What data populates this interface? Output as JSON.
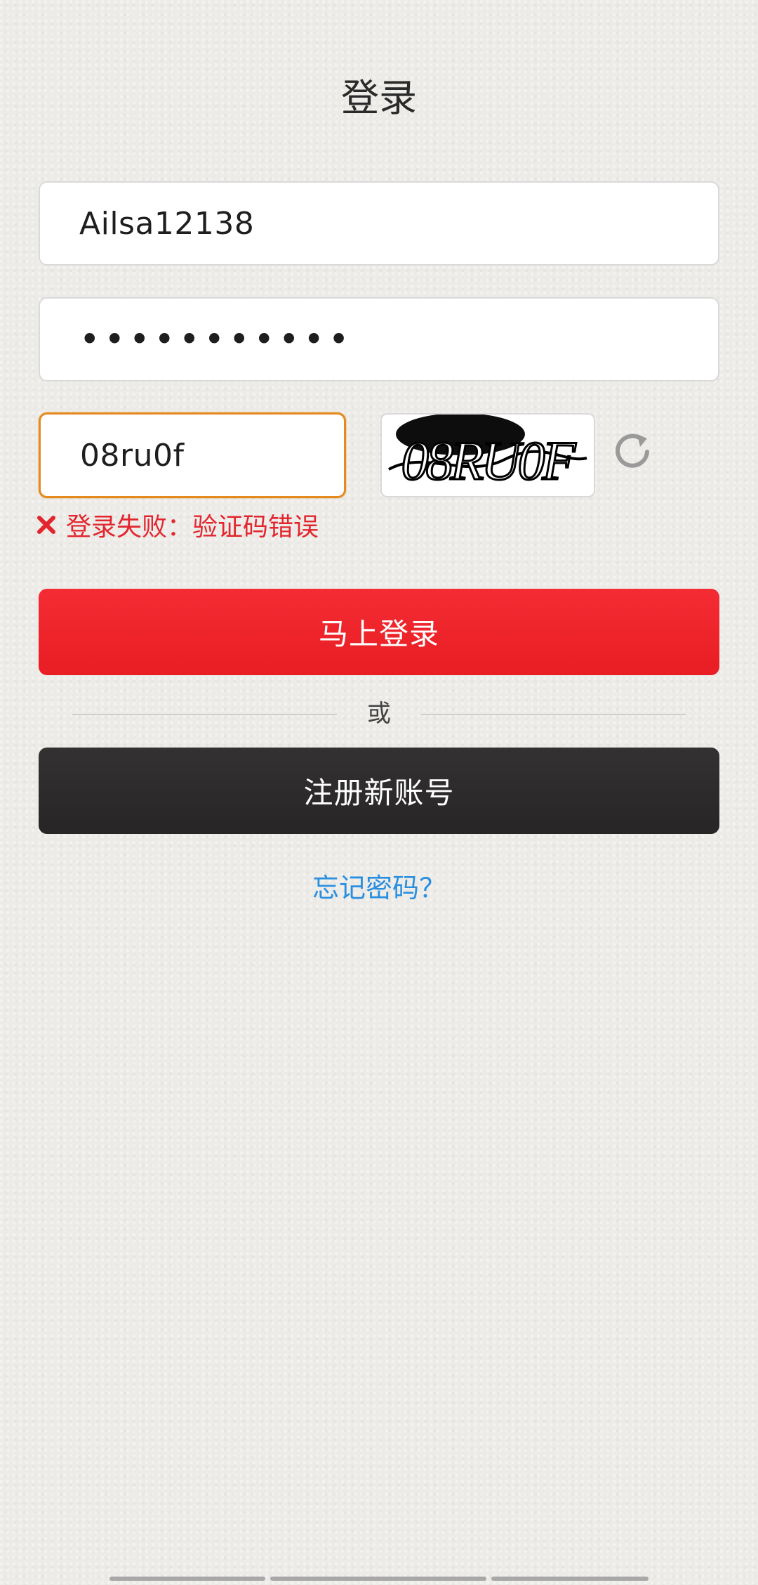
{
  "page": {
    "title": "登录"
  },
  "form": {
    "username_value": "Ailsa12138",
    "password_value": "•••••••••••",
    "captcha_value": "08ru0f",
    "captcha_image_text": "08RU0F"
  },
  "error": {
    "message": "登录失败：验证码错误"
  },
  "buttons": {
    "login_label": "马上登录",
    "or_label": "或",
    "register_label": "注册新账号"
  },
  "links": {
    "forgot_password": "忘记密码？"
  },
  "icons": {
    "refresh": "refresh-icon",
    "error": "close-icon"
  },
  "colors": {
    "accent_red": "#e91d24",
    "dark_button": "#2b2929",
    "link_blue": "#2b8fe0",
    "focus_orange": "#e38b1f"
  }
}
